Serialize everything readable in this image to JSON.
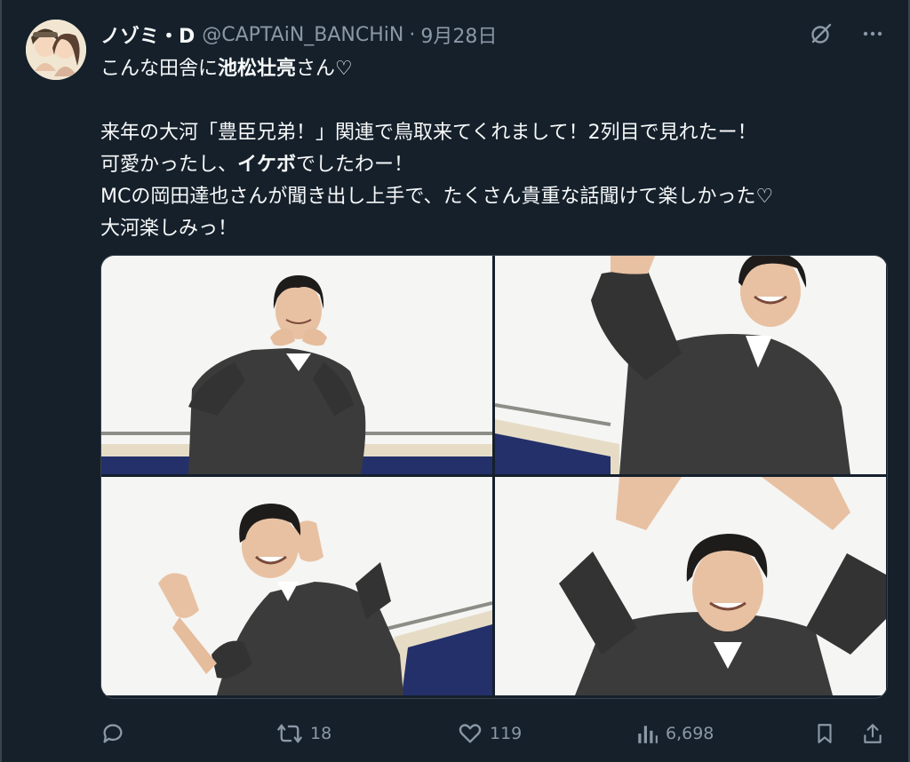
{
  "tweet": {
    "display_name": "ノゾミ・D",
    "handle": "@CAPTAiN_BANCHiN",
    "separator": "·",
    "date": "9月28日",
    "text": {
      "line1_a": "こんな田舎に",
      "line1_bold": "池松壮亮",
      "line1_b": "さん♡",
      "line2": "来年の大河「豊臣兄弟！」関連で鳥取来てくれまして！2列目で見れたー！",
      "line3_a": "可愛かったし、",
      "line3_bold": "イケボ",
      "line3_b": "でしたわー！",
      "line4": "MCの岡田達也さんが聞き出し上手で、たくさん貴重な話聞けて楽しかった♡",
      "line5": "大河楽しみっ！"
    }
  },
  "icons": {
    "grok": "grok-icon",
    "more": "more-icon",
    "reply": "reply-icon",
    "retweet": "retweet-icon",
    "like": "heart-icon",
    "views": "views-icon",
    "bookmark": "bookmark-icon",
    "share": "share-icon"
  },
  "actions": {
    "reply_count": "",
    "retweet_count": "18",
    "like_count": "119",
    "views_count": "6,698"
  },
  "colors": {
    "background": "#15202b",
    "text": "#f7f9f9",
    "secondary": "#8b98a5",
    "border": "#38444d"
  }
}
